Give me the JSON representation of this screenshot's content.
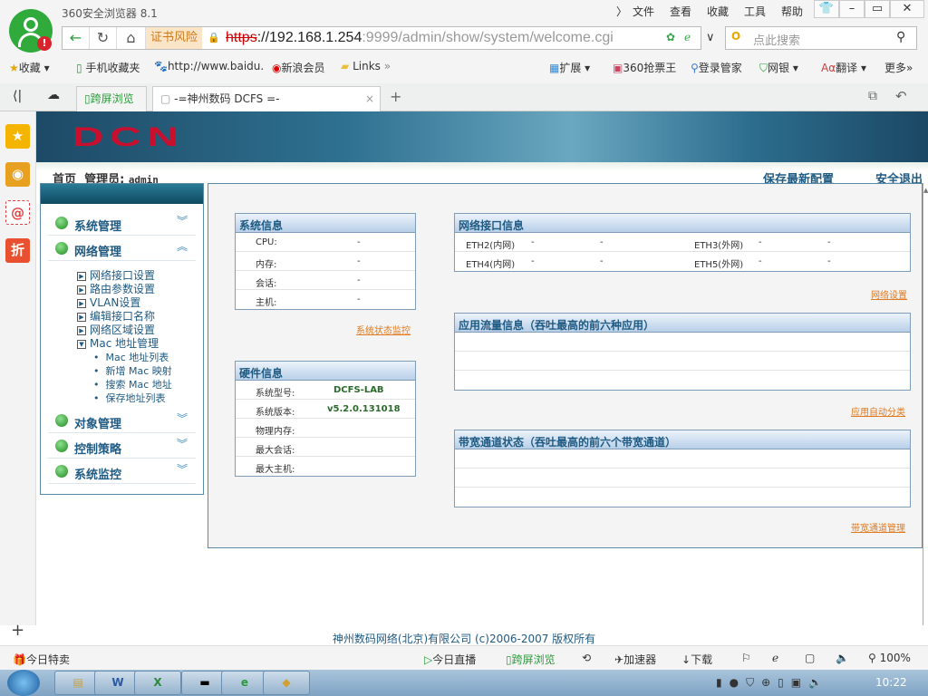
{
  "browser": {
    "title": "360安全浏览器 8.1",
    "menus": [
      "文件",
      "查看",
      "收藏",
      "工具",
      "帮助"
    ],
    "cert_warning": "证书风险",
    "url_scheme": "https",
    "url_host": "://192.168.1.254",
    "url_rest": ":9999/admin/show/system/welcome.cgi",
    "search_placeholder": "点此搜索",
    "bookmarks": [
      "收藏",
      "手机收藏夹",
      "http://www.baidu.",
      "新浪会员",
      "Links"
    ],
    "extensions": [
      "扩展",
      "360抢票王",
      "登录管家",
      "网银",
      "翻译",
      "更多"
    ],
    "tabs": {
      "cross_screen": "跨屏浏览",
      "active": "-=神州数码 DCFS =-"
    }
  },
  "banner": {
    "logo": "DCN"
  },
  "header": {
    "home": "首页",
    "admin_label": "管理员:",
    "admin_user": "admin",
    "save": "保存最新配置",
    "logout": "安全退出"
  },
  "menu": {
    "groups": [
      {
        "label": "系统管理"
      },
      {
        "label": "网络管理"
      },
      {
        "label": "对象管理"
      },
      {
        "label": "控制策略"
      },
      {
        "label": "系统监控"
      }
    ],
    "network_items": [
      "网络接口设置",
      "路由参数设置",
      "VLAN设置",
      "编辑接口名称",
      "网络区域设置",
      "Mac 地址管理"
    ],
    "mac_items": [
      "Mac 地址列表",
      "新增 Mac 映射",
      "搜索 Mac 地址",
      "保存地址列表"
    ]
  },
  "sysinfo": {
    "title": "系统信息",
    "rows": [
      {
        "label": "CPU:",
        "value": "-"
      },
      {
        "label": "内存:",
        "value": "-"
      },
      {
        "label": "会话:",
        "value": "-"
      },
      {
        "label": "主机:",
        "value": "-"
      }
    ],
    "link": "系统状态监控"
  },
  "hwinfo": {
    "title": "硬件信息",
    "rows": [
      {
        "label": "系统型号:",
        "value": "DCFS-LAB"
      },
      {
        "label": "系统版本:",
        "value": "v5.2.0.131018"
      },
      {
        "label": "物理内存:",
        "value": ""
      },
      {
        "label": "最大会话:",
        "value": ""
      },
      {
        "label": "最大主机:",
        "value": ""
      }
    ]
  },
  "netif": {
    "title": "网络接口信息",
    "rows": [
      {
        "a": "ETH2(内网)",
        "a1": "-",
        "a2": "-",
        "b": "ETH3(外网)",
        "b1": "-",
        "b2": "-"
      },
      {
        "a": "ETH4(内网)",
        "a1": "-",
        "a2": "-",
        "b": "ETH5(外网)",
        "b1": "-",
        "b2": "-"
      }
    ],
    "link": "网络设置"
  },
  "appflow": {
    "title": "应用流量信息（吞吐最高的前六种应用）",
    "link": "应用自动分类"
  },
  "bandwidth": {
    "title": "带宽通道状态（吞吐最高的前六个带宽通道）",
    "link": "带宽通道管理"
  },
  "footer": "神州数码网络(北京)有限公司 (c)2006-2007 版权所有",
  "statusbar": {
    "deal": "今日特卖",
    "live": "今日直播",
    "cross": "跨屏浏览",
    "accel": "加速器",
    "download": "下载",
    "zoom": "100%"
  },
  "taskbar": {
    "time": "10:22"
  }
}
